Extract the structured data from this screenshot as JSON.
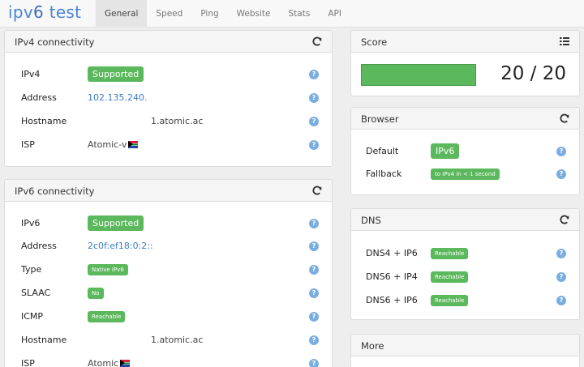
{
  "brand": {
    "part1": "ipv",
    "part2": "6",
    "part3": " test"
  },
  "nav": {
    "tabs": [
      "General",
      "Speed",
      "Ping",
      "Website",
      "Stats",
      "API"
    ],
    "active": "General"
  },
  "ipv4": {
    "title": "IPv4 connectivity",
    "rows": [
      {
        "label": "IPv4",
        "badge": "Supported"
      },
      {
        "label": "Address",
        "value": "102.135.240."
      },
      {
        "label": "Hostname",
        "value": "1.atomic.ac"
      },
      {
        "label": "ISP",
        "value": "Atomic-v"
      }
    ]
  },
  "ipv6": {
    "title": "IPv6 connectivity",
    "rows": [
      {
        "label": "IPv6",
        "badge": "Supported"
      },
      {
        "label": "Address",
        "value": "2c0f:ef18:0:2::"
      },
      {
        "label": "Type",
        "badge": "Native IPv6"
      },
      {
        "label": "SLAAC",
        "badge": "No"
      },
      {
        "label": "ICMP",
        "badge": "Reachable"
      },
      {
        "label": "Hostname",
        "value": "1.atomic.ac"
      },
      {
        "label": "ISP",
        "value": "Atomic"
      }
    ]
  },
  "score": {
    "title": "Score",
    "value": "20 / 20",
    "fill_fraction": 1.0
  },
  "browser": {
    "title": "Browser",
    "rows": [
      {
        "label": "Default",
        "badge": "IPv6"
      },
      {
        "label": "Fallback",
        "badge": "to IPv4 in < 1 second"
      }
    ]
  },
  "dns": {
    "title": "DNS",
    "rows": [
      {
        "label": "DNS4 + IP6",
        "badge": "Reachable"
      },
      {
        "label": "DNS6 + IP4",
        "badge": "Reachable"
      },
      {
        "label": "DNS6 + IP6",
        "badge": "Reachable"
      }
    ]
  },
  "more": {
    "title": "More"
  },
  "help_glyph": "?",
  "colors": {
    "success": "#5cb85c",
    "link": "#3b7dc4",
    "help": "#7aaee0",
    "brand": "#4a84d6"
  }
}
